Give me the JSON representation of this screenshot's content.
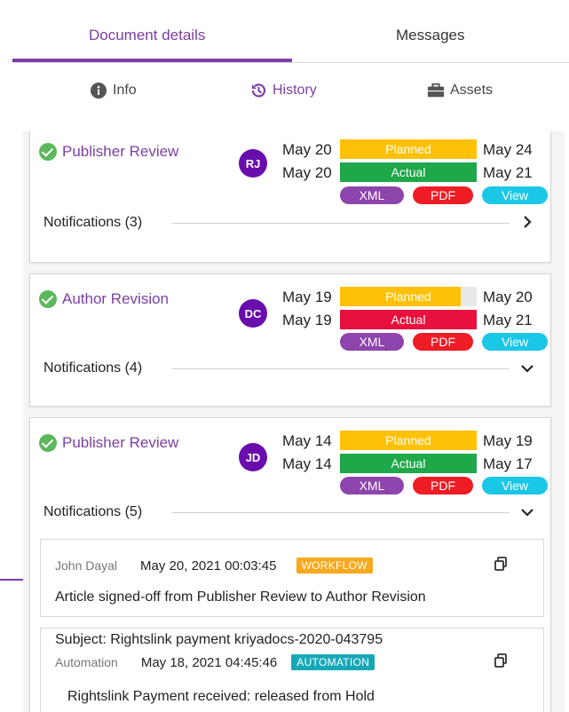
{
  "tabs": {
    "document_details": "Document details",
    "messages": "Messages"
  },
  "subtabs": {
    "info": "Info",
    "history": "History",
    "assets": "Assets"
  },
  "cards": [
    {
      "stage": "Publisher Review",
      "initials": "RJ",
      "planned_start": "May 20",
      "planned_end": "May 24",
      "actual_start": "May 20",
      "actual_end": "May 21",
      "planned_label": "Planned",
      "actual_label": "Actual",
      "planned_fill": 1.0,
      "actual_status": "on-time",
      "xml": "XML",
      "pdf": "PDF",
      "view": "View",
      "notifications": "Notifications (3)"
    },
    {
      "stage": "Author Revision",
      "initials": "DC",
      "planned_start": "May 19",
      "planned_end": "May 20",
      "actual_start": "May 19",
      "actual_end": "May 21",
      "planned_label": "Planned",
      "actual_label": "Actual",
      "planned_fill": 0.88,
      "actual_status": "late",
      "xml": "XML",
      "pdf": "PDF",
      "view": "View",
      "notifications": "Notifications (4)"
    },
    {
      "stage": "Publisher Review",
      "initials": "JD",
      "planned_start": "May 14",
      "planned_end": "May 19",
      "actual_start": "May 14",
      "actual_end": "May 17",
      "planned_label": "Planned",
      "actual_label": "Actual",
      "planned_fill": 1.0,
      "actual_status": "on-time",
      "xml": "XML",
      "pdf": "PDF",
      "view": "View",
      "notifications": "Notifications (5)"
    }
  ],
  "notification_items": [
    {
      "author": "John Dayal",
      "datetime": "May 20, 2021 00:03:45",
      "badge": "WORKFLOW",
      "text": "Article signed-off from Publisher Review to Author Revision"
    },
    {
      "subject": "Subject: Rightslink payment kriyadocs-2020-043795",
      "author": "Automation",
      "datetime": "May 18, 2021 04:45:46",
      "badge": "AUTOMATION",
      "text": "Rightslink Payment received: released from Hold"
    }
  ],
  "colors": {
    "accent": "#7a3fa3",
    "planned": "#ffc107",
    "actual_ok": "#1fa84a",
    "actual_late": "#e8113d",
    "xml": "#8e44ad",
    "pdf": "#ee1c25",
    "view": "#1bc7e6",
    "avatar": "#6a0dad",
    "check": "#5cb85c",
    "workflow": "#f7a81e",
    "automation": "#17a8b8"
  }
}
